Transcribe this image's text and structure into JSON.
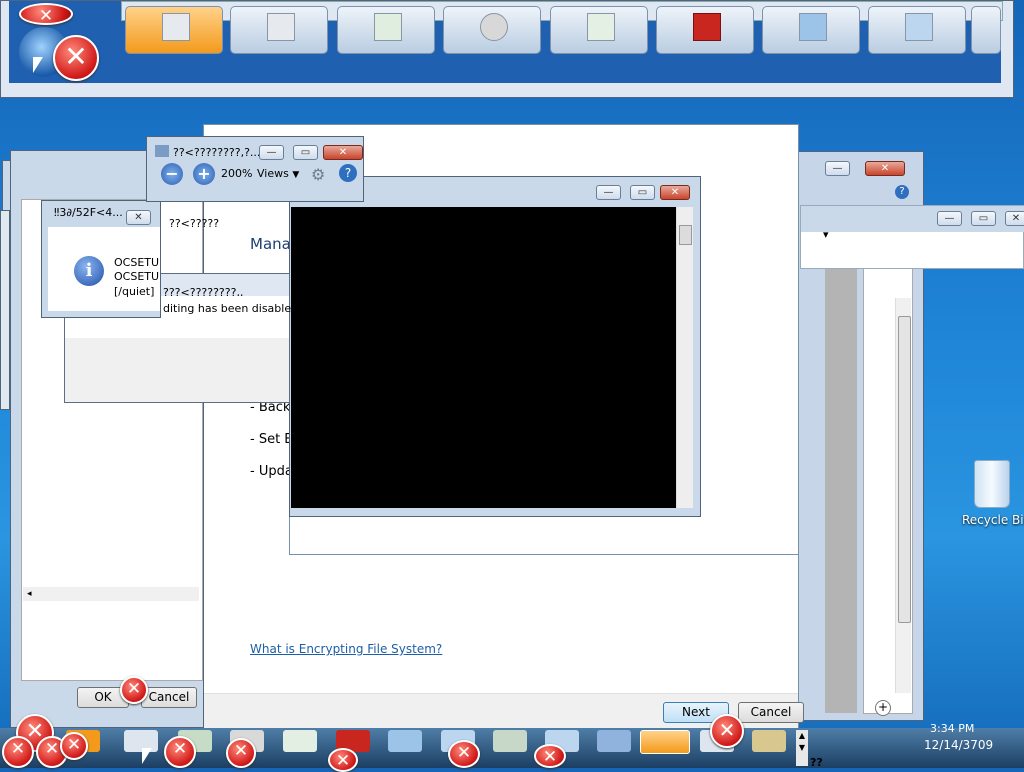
{
  "background_window": {
    "tiles": [
      {
        "icon": "document-orange-icon"
      },
      {
        "icon": "blank-window-icon"
      },
      {
        "icon": "spreadsheet-icon"
      },
      {
        "icon": "disc-icon"
      },
      {
        "icon": "document-green-icon"
      },
      {
        "icon": "toolbox-icon"
      },
      {
        "icon": "computer-search-icon"
      },
      {
        "icon": "computer-icon"
      },
      {
        "icon": "window-icon"
      }
    ]
  },
  "photo_viewer": {
    "title": "??<????????,?...",
    "zoom": "200%",
    "views_label": "Views",
    "minimize": "—",
    "maximize": "▭",
    "close": "✕"
  },
  "info_dialog": {
    "title": "‼3∂/52F<4...",
    "lines": [
      "OCSETU",
      "OCSETU",
      "[/quiet]"
    ],
    "close": "✕"
  },
  "printer_window": {
    "title": "??<????????,,?????",
    "sub_line": "??<????????..?????..??",
    "tab_partial": "??<?????"
  },
  "error_dialog": {
    "title": "???<????????,,",
    "message": "diting has been disabled"
  },
  "left_dialog": {
    "ok": "OK",
    "cancel": "Cancel"
  },
  "efs_wizard": {
    "heading_partial": "Mana",
    "items": [
      "- Back",
      "- Set E",
      "- Upda"
    ],
    "link": "What is Encrypting File System?",
    "next": "Next",
    "cancel": "Cancel"
  },
  "right_window": {
    "dropdown_arrow": "▾",
    "help": "?"
  },
  "desktop": {
    "recycle_bin": "Recycle Bin"
  },
  "taskbar": {
    "time": "3:34 PM",
    "date": "12/14/3709",
    "tray_text": "??"
  }
}
